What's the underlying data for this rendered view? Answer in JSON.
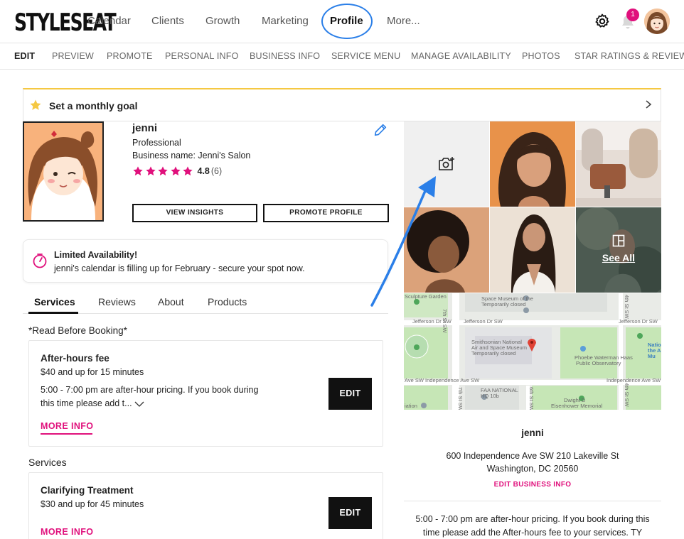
{
  "logo": "STYLESEAT",
  "nav": {
    "items": [
      "Calendar",
      "Clients",
      "Growth",
      "Marketing",
      "Profile",
      "More..."
    ],
    "notification_count": "1"
  },
  "subnav": [
    "EDIT",
    "PREVIEW",
    "PROMOTE",
    "PERSONAL INFO",
    "BUSINESS INFO",
    "SERVICE MENU",
    "MANAGE AVAILABILITY",
    "PHOTOS",
    "STAR RATINGS & REVIEWS"
  ],
  "goal": {
    "label": "Set a monthly goal"
  },
  "profile": {
    "name": "jenni",
    "role": "Professional",
    "business": "Business name: Jenni's Salon",
    "rating": "4.8",
    "review_count": "(6)",
    "stars": 5,
    "view_insights": "VIEW INSIGHTS",
    "promote_profile": "PROMOTE PROFILE"
  },
  "availability": {
    "title": "Limited Availability!",
    "message": "jenni's calendar is filling up for February - secure your spot now."
  },
  "tabs": [
    "Services",
    "Reviews",
    "About",
    "Products"
  ],
  "read_before": "*Read Before Booking*",
  "services_heading": "Services",
  "cards": [
    {
      "title": "After-hours fee",
      "price": "$40 and up for 15 minutes",
      "desc_line1": "5:00 - 7:00 pm are after-hour pricing. If you book during",
      "desc_line2": "this time please add t...",
      "more": "MORE INFO",
      "edit": "EDIT"
    },
    {
      "title": "Clarifying Treatment",
      "price": "$30 and up for 45 minutes",
      "more": "MORE INFO",
      "edit": "EDIT"
    }
  ],
  "gallery": {
    "see_all": "See All"
  },
  "map_labels": {
    "garden": "Sculpture Garden",
    "museum_top": "Space Museum of the",
    "closed_top": "Temporarily closed",
    "jefferson_left": "Jefferson Dr SW",
    "jefferson_mid": "Jefferson Dr SW",
    "jefferson_right": "Jefferson Dr SW",
    "smithsonian1": "Smithsonian National",
    "smithsonian2": "Air and Space Museum",
    "smithsonian3": "Temporarily closed",
    "phoebe1": "Phoebe Waterman Haas",
    "phoebe2": "Public Observatory",
    "independence_left": "Ave SW  Independence Ave SW",
    "independence_right": "Independence Ave SW",
    "faa1": "FAA NATIONAL",
    "faa2": "HQ 10b",
    "dwight1": "Dwight D",
    "dwight2": "Eisenhower Memorial",
    "station": "iation",
    "st7": "7th St SW",
    "st6": "6th St SW",
    "st4": "4th St SW",
    "natio1": "Natio",
    "natio2": "the A",
    "natio3": "Mu"
  },
  "business": {
    "name": "jenni",
    "address1": "600 Independence Ave SW 210 Lakeville St",
    "address2": "Washington, DC 20560",
    "edit": "EDIT BUSINESS INFO",
    "note1": "5:00 - 7:00 pm are after-hour pricing. If you book during this",
    "note2": "time please add the After-hours fee to your services. TY"
  },
  "colors": {
    "accent": "#e0107c",
    "annotation": "#2b7fe8",
    "goal_border": "#f5c842",
    "star": "#e0107c"
  }
}
